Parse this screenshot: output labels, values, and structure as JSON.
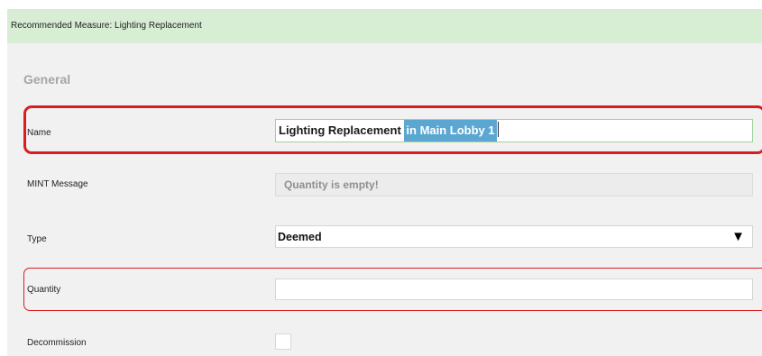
{
  "header": {
    "title": "Recommended Measure: Lighting Replacement"
  },
  "section": {
    "title": "General"
  },
  "fields": {
    "name": {
      "label": "Name",
      "value_prefix": "Lighting Replacement ",
      "value_selected": "in Main Lobby 1"
    },
    "mint_message": {
      "label": "MINT Message",
      "value": "Quantity is empty!"
    },
    "type": {
      "label": "Type",
      "value": "Deemed",
      "arrow_icon": "▼"
    },
    "quantity": {
      "label": "Quantity",
      "value": ""
    },
    "decommission": {
      "label": "Decommission",
      "checked": false
    }
  },
  "colors": {
    "header_bg": "#d7eed5",
    "panel_bg": "#f1f1f1",
    "highlight_red": "#d81e1e",
    "selection_blue": "#5ba7d2",
    "focused_border_green": "#9fd29a"
  }
}
